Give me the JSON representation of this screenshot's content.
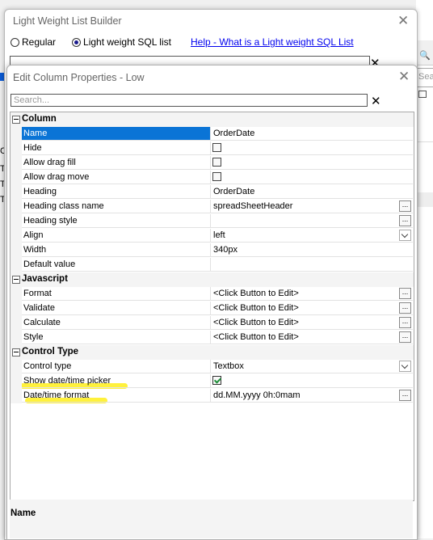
{
  "background": {
    "right_search_placeholder": "Sea",
    "left_fragments": [
      "C",
      "Te",
      "Te",
      "Te"
    ]
  },
  "outer_dialog": {
    "title": "Light Weight List Builder",
    "close_glyph": "✕",
    "radio_regular": "Regular",
    "radio_light": "Light weight SQL list",
    "selected_radio": "Light weight SQL list",
    "help_link": "Help - What is a Light weight SQL List",
    "search_placeholder": "Search...",
    "search_clear": "✕"
  },
  "inner_dialog": {
    "title": "Edit Column Properties - Low",
    "close_glyph": "✕",
    "search_placeholder": "Search...",
    "search_clear": "✕"
  },
  "categories": [
    {
      "label": "Column",
      "rows": [
        {
          "name": "Name",
          "value": "OrderDate",
          "type": "text",
          "selected": true
        },
        {
          "name": "Hide",
          "value": "",
          "type": "checkbox",
          "checked": false
        },
        {
          "name": "Allow drag fill",
          "value": "",
          "type": "checkbox",
          "checked": false
        },
        {
          "name": "Allow drag move",
          "value": "",
          "type": "checkbox",
          "checked": false
        },
        {
          "name": "Heading",
          "value": "OrderDate",
          "type": "text"
        },
        {
          "name": "Heading class name",
          "value": "spreadSheetHeader",
          "type": "ellipsis"
        },
        {
          "name": "Heading style",
          "value": "",
          "type": "ellipsis"
        },
        {
          "name": "Align",
          "value": "left",
          "type": "dropdown"
        },
        {
          "name": "Width",
          "value": "340px",
          "type": "text"
        },
        {
          "name": "Default value",
          "value": "",
          "type": "text"
        }
      ]
    },
    {
      "label": "Javascript",
      "rows": [
        {
          "name": "Format",
          "value": "<Click Button to Edit>",
          "type": "ellipsis"
        },
        {
          "name": "Validate",
          "value": "<Click Button to Edit>",
          "type": "ellipsis"
        },
        {
          "name": "Calculate",
          "value": "<Click Button to Edit>",
          "type": "ellipsis"
        },
        {
          "name": "Style",
          "value": "<Click Button to Edit>",
          "type": "ellipsis"
        }
      ]
    },
    {
      "label": "Control Type",
      "rows": [
        {
          "name": "Control type",
          "value": "Textbox",
          "type": "dropdown"
        },
        {
          "name": "Show date/time  picker",
          "value": "",
          "type": "checkbox",
          "checked": true,
          "highlighted": true
        },
        {
          "name": "Date/time format",
          "value": "dd.MM.yyyy 0h:0mam",
          "type": "ellipsis",
          "highlighted": true
        }
      ]
    }
  ],
  "description_title": "Name",
  "button_glyph": "...",
  "colors": {
    "selection": "#0a74d6",
    "highlighter": "#ffef1a",
    "link": "#0000ee",
    "check": "#1f8f3a"
  }
}
